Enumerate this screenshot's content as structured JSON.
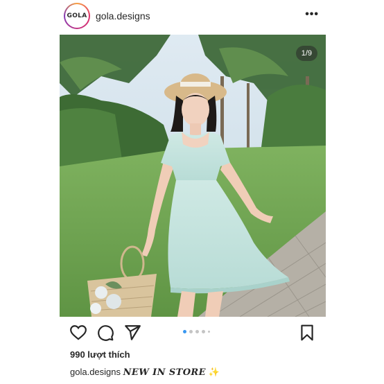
{
  "post": {
    "username": "gola.designs",
    "avatar_logo": "GOLA",
    "more_label": "•••",
    "image_counter": "1/9",
    "carousel": {
      "total_dots": 5,
      "active_index": 0
    },
    "likes": "990 lượt thích",
    "caption": {
      "username": "gola.designs",
      "text": "NEW IN STORE",
      "emoji": "✨"
    }
  },
  "icons": [
    "heart-icon",
    "comment-icon",
    "share-icon",
    "bookmark-icon"
  ],
  "colors": {
    "accent_dot": "#3897f0",
    "text": "#262626"
  }
}
